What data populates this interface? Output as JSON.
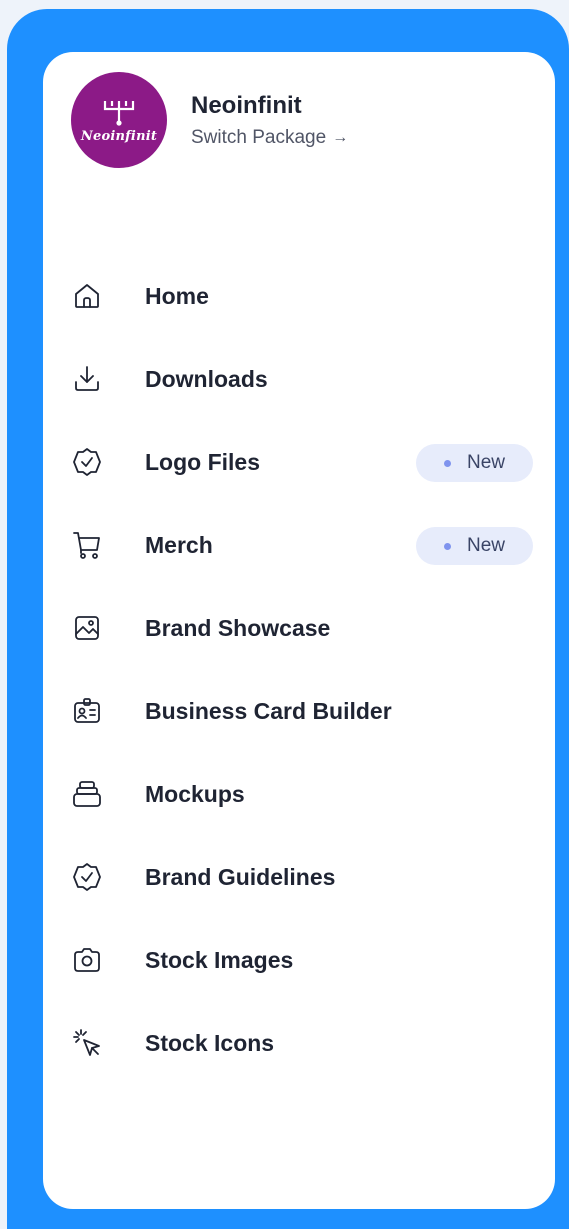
{
  "profile": {
    "company_name": "Neoinfinit",
    "switch_label": "Switch Package",
    "switch_arrow": "→",
    "avatar_brand": "Neoinfinit",
    "avatar_color": "#8c1a87"
  },
  "nav": {
    "items": [
      {
        "label": "Home",
        "icon": "home-icon"
      },
      {
        "label": "Downloads",
        "icon": "download-icon"
      },
      {
        "label": "Logo Files",
        "icon": "badge-check-icon",
        "badge": "New"
      },
      {
        "label": "Merch",
        "icon": "cart-icon",
        "badge": "New"
      },
      {
        "label": "Brand Showcase",
        "icon": "image-icon"
      },
      {
        "label": "Business Card Builder",
        "icon": "id-card-icon"
      },
      {
        "label": "Mockups",
        "icon": "layers-icon"
      },
      {
        "label": "Brand Guidelines",
        "icon": "badge-check-icon"
      },
      {
        "label": "Stock Images",
        "icon": "camera-icon"
      },
      {
        "label": "Stock Icons",
        "icon": "cursor-click-icon"
      }
    ]
  },
  "colors": {
    "frame": "#1e90ff",
    "badge_bg": "#e7ecfb",
    "badge_dot": "#7f93ee"
  }
}
